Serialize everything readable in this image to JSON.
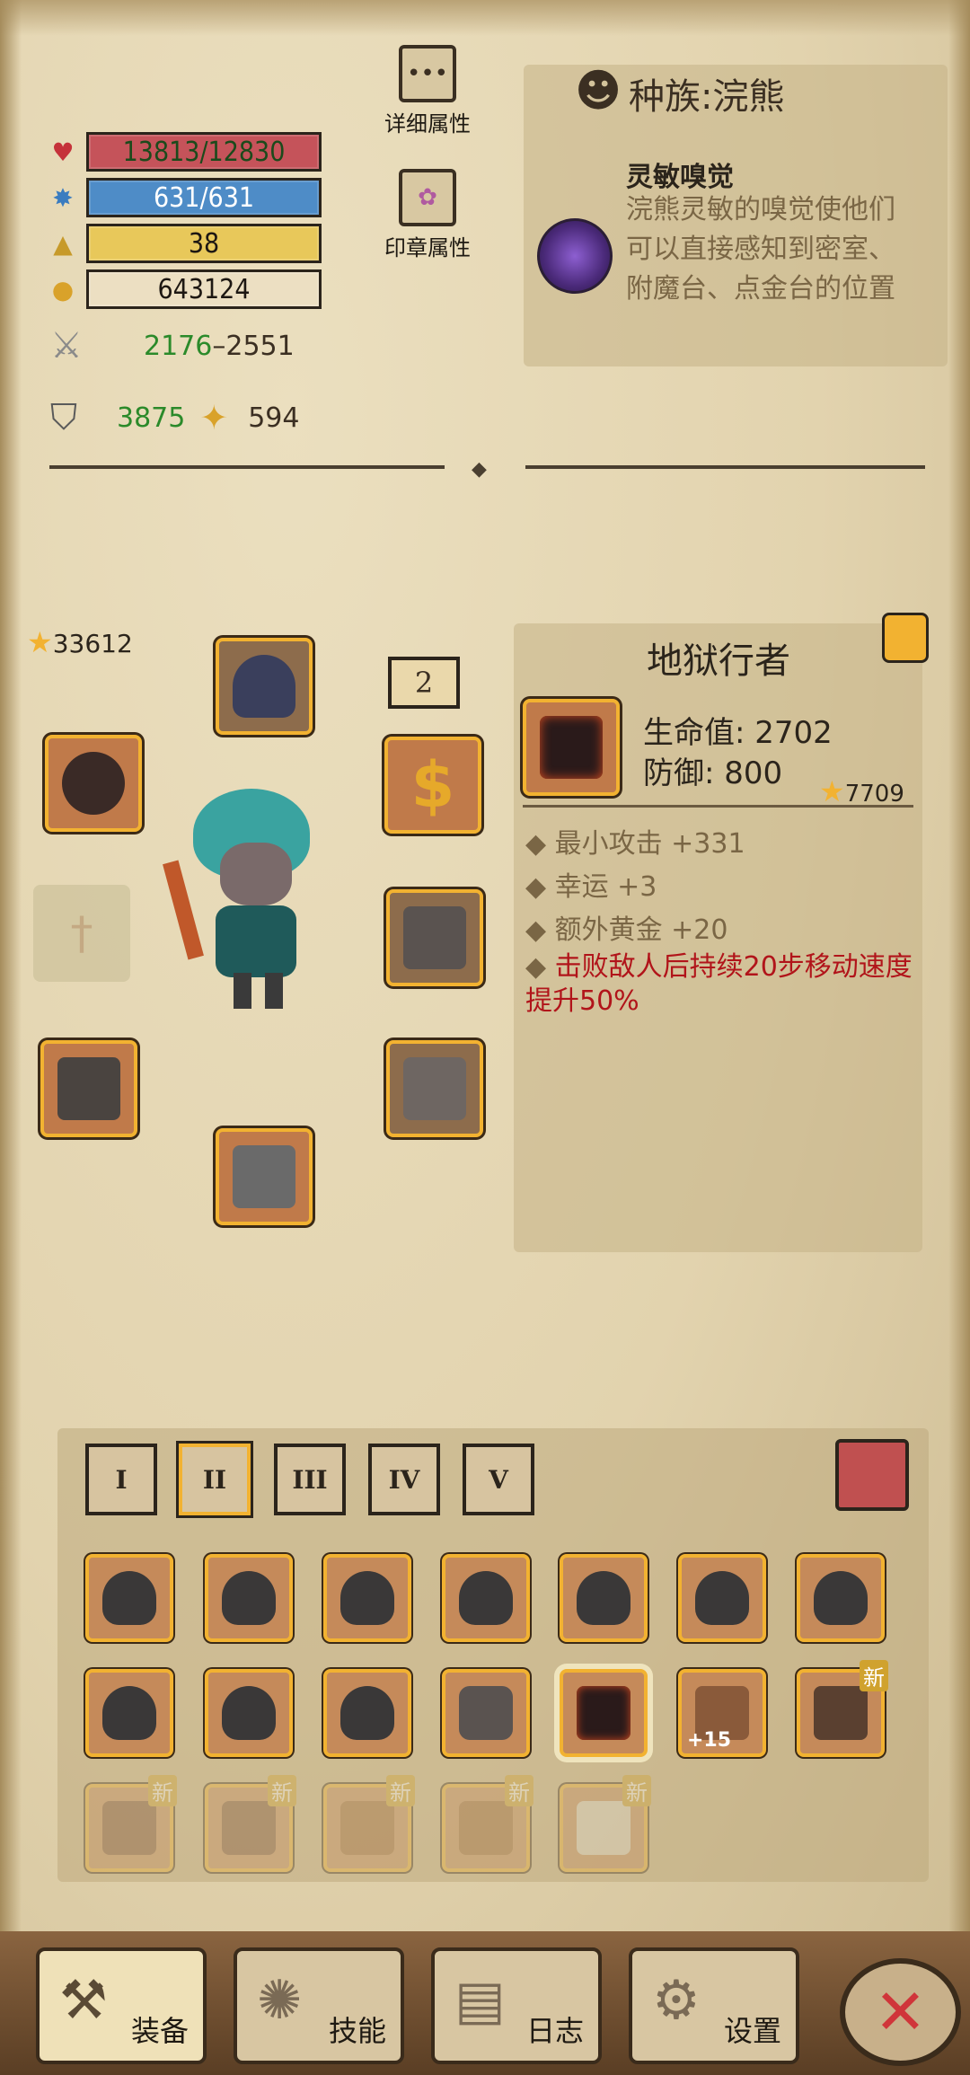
{
  "stats": {
    "hp": "13813/12830",
    "mp": "631/631",
    "level": "38",
    "gold": "643124",
    "attack_min": "2176",
    "attack_sep": "–",
    "attack_max": "2551",
    "defense": "3875",
    "luck": "594"
  },
  "buttons": {
    "details": "详细属性",
    "seal": "印章属性"
  },
  "race": {
    "title": "种族:浣熊",
    "trait_title": "灵敏嗅觉",
    "trait_desc": "浣熊灵敏的嗅觉使他们可以直接感知到密室、附魔台、点金台的位置"
  },
  "equipment": {
    "total_power": "33612",
    "ring_count": "2"
  },
  "item_detail": {
    "name": "地狱行者",
    "hp_label": "生命值: 2702",
    "def_label": "防御: 800",
    "power": "7709",
    "attrs": [
      "最小攻击 +331",
      "幸运 +3",
      "额外黄金 +20",
      "击败敌人后持续20步移动速度提升50%"
    ]
  },
  "inventory": {
    "tabs": [
      "I",
      "II",
      "III",
      "IV",
      "V"
    ],
    "active_tab": "II",
    "new_tag": "新",
    "plus_tag": "+15"
  },
  "nav": {
    "equip": "装备",
    "skills": "技能",
    "log": "日志",
    "settings": "设置"
  },
  "colors": {
    "hp_bar": "#c5535a",
    "mp_bar": "#4e8cc7",
    "level_bar": "#e8c85a",
    "slot_border": "#f2b231",
    "red_text": "#b1141a"
  }
}
